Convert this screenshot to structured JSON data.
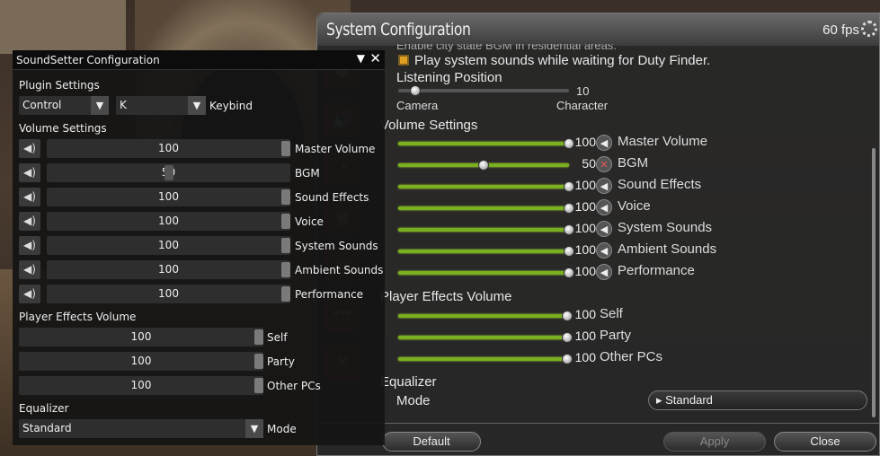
{
  "syscfg": {
    "title": "System Configuration",
    "fps": "60 fps",
    "partial_line": "Enable city state BGM in residential areas.",
    "duty_check_label": "Play system sounds while waiting for Duty Finder.",
    "listening": {
      "heading": "Listening Position",
      "value": "10",
      "left_label": "Camera",
      "right_label": "Character",
      "level": 0.1
    },
    "volume_heading": "Volume Settings",
    "volume_rows": [
      {
        "label": "Master Volume",
        "value": "100",
        "level": 1.0,
        "muted": false
      },
      {
        "label": "BGM",
        "value": "50",
        "level": 0.5,
        "muted": true
      },
      {
        "label": "Sound Effects",
        "value": "100",
        "level": 1.0,
        "muted": false
      },
      {
        "label": "Voice",
        "value": "100",
        "level": 1.0,
        "muted": false
      },
      {
        "label": "System Sounds",
        "value": "100",
        "level": 1.0,
        "muted": false
      },
      {
        "label": "Ambient Sounds",
        "value": "100",
        "level": 1.0,
        "muted": false
      },
      {
        "label": "Performance",
        "value": "100",
        "level": 1.0,
        "muted": false
      }
    ],
    "player_heading": "Player Effects Volume",
    "player_rows": [
      {
        "label": "Self",
        "value": "100",
        "level": 1.0
      },
      {
        "label": "Party",
        "value": "100",
        "level": 1.0
      },
      {
        "label": "Other PCs",
        "value": "100",
        "level": 1.0
      }
    ],
    "eq_heading": "Equalizer",
    "mode_label": "Mode",
    "mode_value": "Standard",
    "buttons": {
      "default": "Default",
      "apply": "Apply",
      "close": "Close"
    }
  },
  "soundsetter": {
    "title": "SoundSetter Configuration",
    "plugin_heading": "Plugin Settings",
    "modifier": "Control",
    "key": "K",
    "keybind_label": "Keybind",
    "volume_heading": "Volume Settings",
    "volume_rows": [
      {
        "label": "Master Volume",
        "value": "100",
        "level": 1.0
      },
      {
        "label": "BGM",
        "value": "50",
        "level": 0.5
      },
      {
        "label": "Sound Effects",
        "value": "100",
        "level": 1.0
      },
      {
        "label": "Voice",
        "value": "100",
        "level": 1.0
      },
      {
        "label": "System Sounds",
        "value": "100",
        "level": 1.0
      },
      {
        "label": "Ambient Sounds",
        "value": "100",
        "level": 1.0
      },
      {
        "label": "Performance",
        "value": "100",
        "level": 1.0
      }
    ],
    "player_heading": "Player Effects Volume",
    "player_rows": [
      {
        "label": "Self",
        "value": "100",
        "level": 1.0
      },
      {
        "label": "Party",
        "value": "100",
        "level": 1.0
      },
      {
        "label": "Other PCs",
        "value": "100",
        "level": 1.0
      }
    ],
    "eq_heading": "Equalizer",
    "mode_value": "Standard",
    "mode_label": "Mode"
  }
}
